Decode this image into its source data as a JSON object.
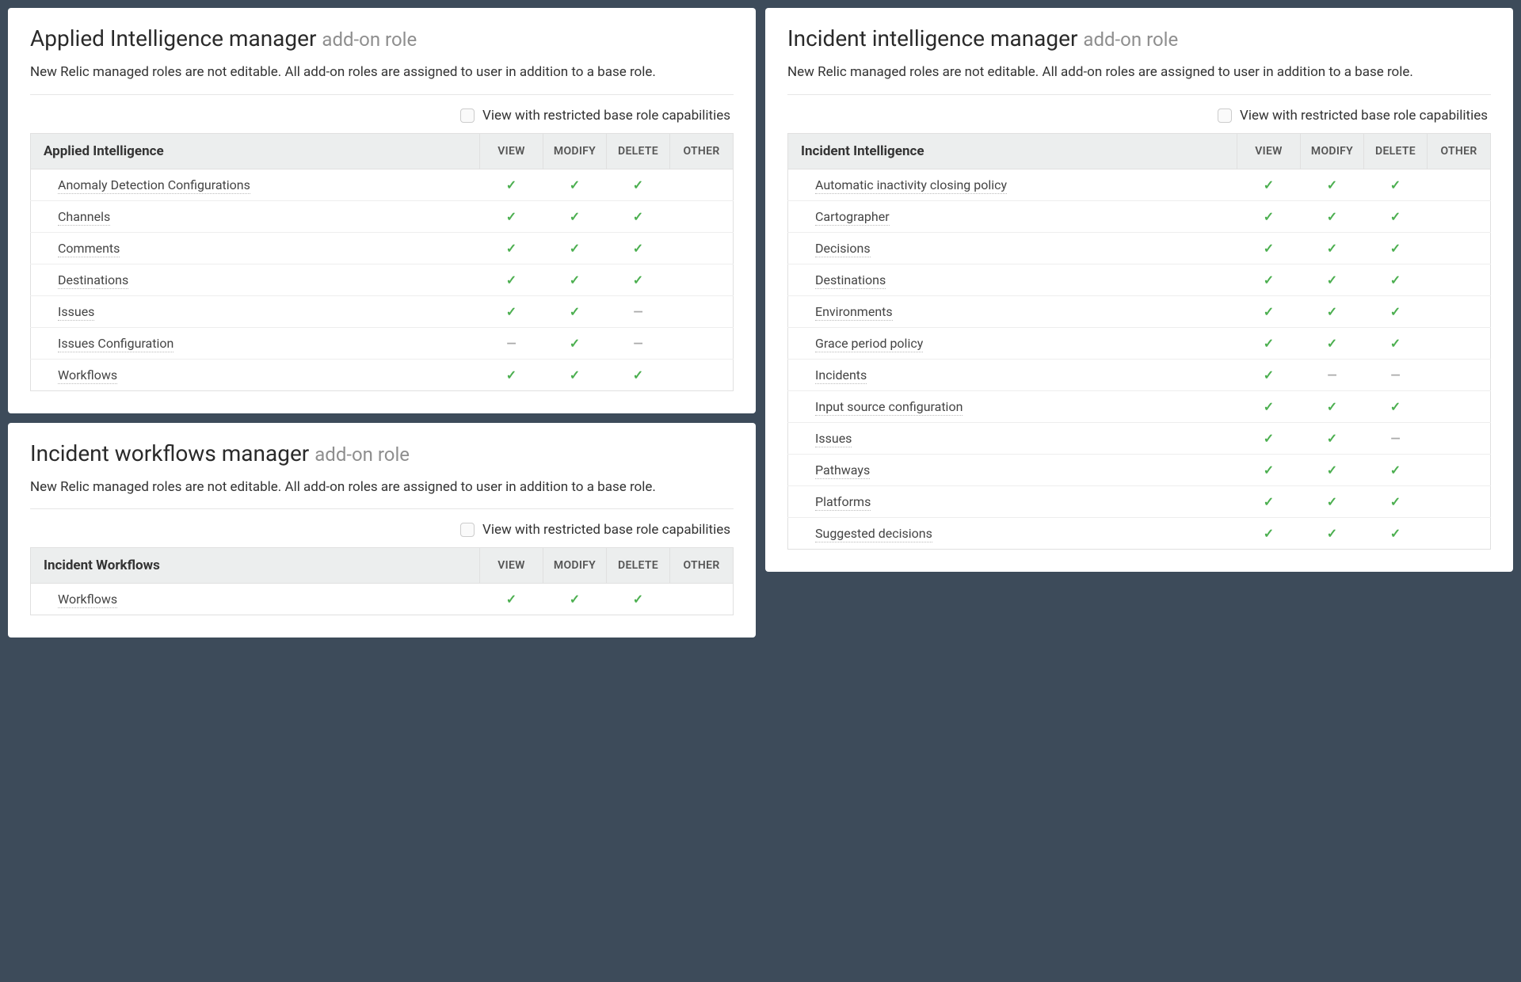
{
  "common": {
    "suffix": "add-on role",
    "description": "New Relic managed roles are not editable. All add-on roles are assigned to user in addition to a base role.",
    "restrict_label": "View with restricted base role capabilities",
    "columns": {
      "view": "VIEW",
      "modify": "MODIFY",
      "delete": "DELETE",
      "other": "OTHER"
    },
    "icons": {
      "check": "✓",
      "dash": "—"
    }
  },
  "panels": [
    {
      "id": "applied-intelligence",
      "title": "Applied Intelligence manager",
      "section": "Applied Intelligence",
      "rows": [
        {
          "name": "Anomaly Detection Configurations",
          "view": "check",
          "modify": "check",
          "delete": "check",
          "other": ""
        },
        {
          "name": "Channels",
          "view": "check",
          "modify": "check",
          "delete": "check",
          "other": ""
        },
        {
          "name": "Comments",
          "view": "check",
          "modify": "check",
          "delete": "check",
          "other": ""
        },
        {
          "name": "Destinations",
          "view": "check",
          "modify": "check",
          "delete": "check",
          "other": ""
        },
        {
          "name": "Issues",
          "view": "check",
          "modify": "check",
          "delete": "dash",
          "other": ""
        },
        {
          "name": "Issues Configuration",
          "view": "dash",
          "modify": "check",
          "delete": "dash",
          "other": ""
        },
        {
          "name": "Workflows",
          "view": "check",
          "modify": "check",
          "delete": "check",
          "other": ""
        }
      ]
    },
    {
      "id": "incident-workflows",
      "title": "Incident workflows manager",
      "section": "Incident Workflows",
      "rows": [
        {
          "name": "Workflows",
          "view": "check",
          "modify": "check",
          "delete": "check",
          "other": ""
        }
      ]
    },
    {
      "id": "incident-intelligence",
      "title": "Incident intelligence manager",
      "section": "Incident Intelligence",
      "rows": [
        {
          "name": "Automatic inactivity closing policy",
          "view": "check",
          "modify": "check",
          "delete": "check",
          "other": ""
        },
        {
          "name": "Cartographer",
          "view": "check",
          "modify": "check",
          "delete": "check",
          "other": ""
        },
        {
          "name": "Decisions",
          "view": "check",
          "modify": "check",
          "delete": "check",
          "other": ""
        },
        {
          "name": "Destinations",
          "view": "check",
          "modify": "check",
          "delete": "check",
          "other": ""
        },
        {
          "name": "Environments",
          "view": "check",
          "modify": "check",
          "delete": "check",
          "other": ""
        },
        {
          "name": "Grace period policy",
          "view": "check",
          "modify": "check",
          "delete": "check",
          "other": ""
        },
        {
          "name": "Incidents",
          "view": "check",
          "modify": "dash",
          "delete": "dash",
          "other": ""
        },
        {
          "name": "Input source configuration",
          "view": "check",
          "modify": "check",
          "delete": "check",
          "other": ""
        },
        {
          "name": "Issues",
          "view": "check",
          "modify": "check",
          "delete": "dash",
          "other": ""
        },
        {
          "name": "Pathways",
          "view": "check",
          "modify": "check",
          "delete": "check",
          "other": ""
        },
        {
          "name": "Platforms",
          "view": "check",
          "modify": "check",
          "delete": "check",
          "other": ""
        },
        {
          "name": "Suggested decisions",
          "view": "check",
          "modify": "check",
          "delete": "check",
          "other": ""
        }
      ]
    }
  ]
}
